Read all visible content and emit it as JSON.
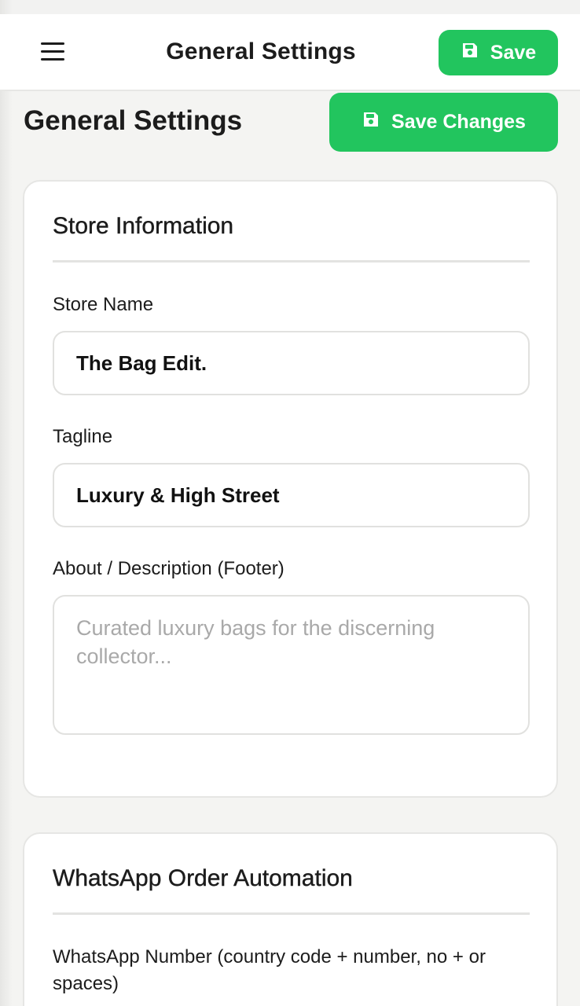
{
  "topbar": {
    "menu_icon": "hamburger-menu-icon",
    "title": "General Settings",
    "save_label": "Save",
    "save_icon": "floppy-disk-icon"
  },
  "page": {
    "title": "General Settings",
    "save_changes_label": "Save Changes",
    "save_changes_icon": "floppy-disk-icon"
  },
  "store_info": {
    "title": "Store Information",
    "store_name": {
      "label": "Store Name",
      "value": "The Bag Edit."
    },
    "tagline": {
      "label": "Tagline",
      "value": "Luxury & High Street"
    },
    "about": {
      "label": "About / Description (Footer)",
      "value": "",
      "placeholder": "Curated luxury bags for the discerning collector..."
    }
  },
  "whatsapp": {
    "title": "WhatsApp Order Automation",
    "number_label": "WhatsApp Number (country code + number, no + or spaces)"
  },
  "colors": {
    "accent": "#22c55e",
    "background": "#f4f4f2",
    "card": "#ffffff",
    "text": "#1c1c1c",
    "placeholder": "#a9a9a9"
  }
}
